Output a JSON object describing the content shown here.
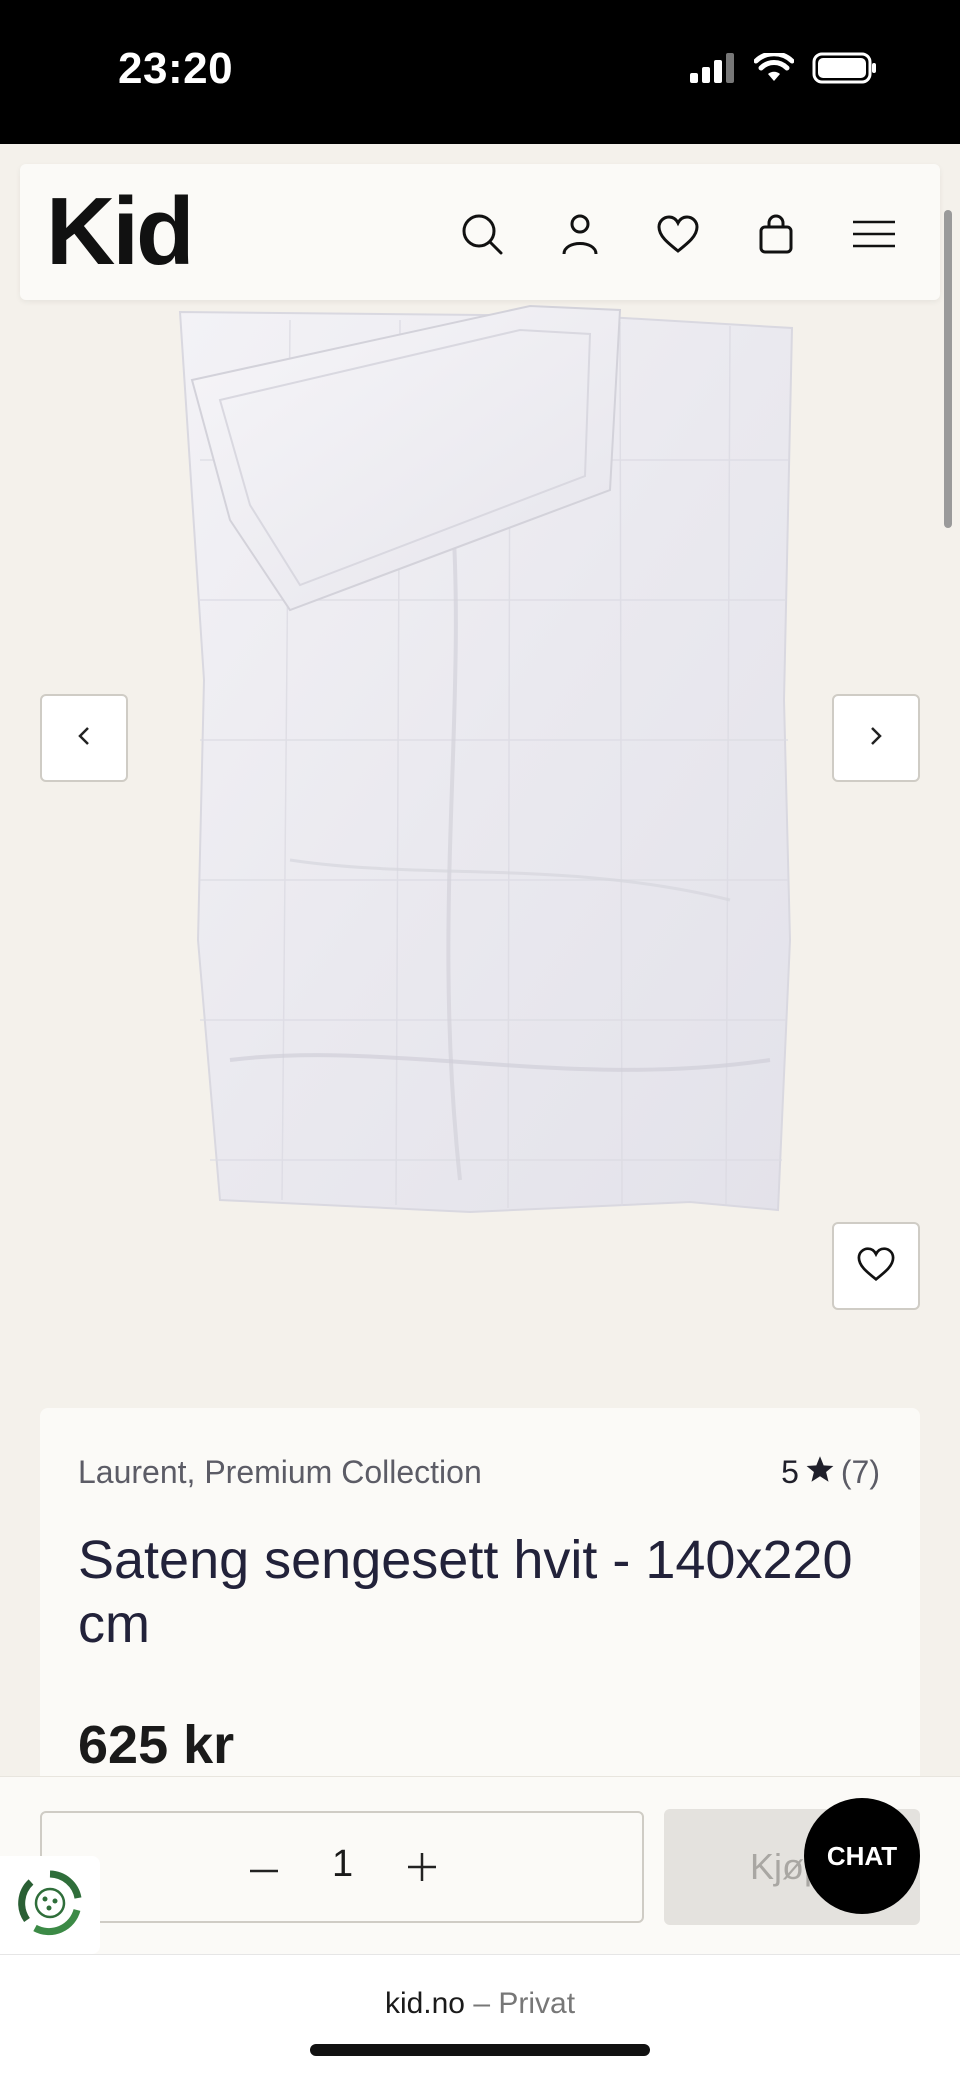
{
  "status_bar": {
    "time": "23:20"
  },
  "header": {
    "logo": "Kid",
    "icons": [
      "search-icon",
      "account-icon",
      "heart-icon",
      "bag-icon",
      "menu-icon"
    ]
  },
  "gallery": {
    "prev_icon": "chevron-left-icon",
    "next_icon": "chevron-right-icon",
    "favorite_icon": "heart-icon"
  },
  "product": {
    "brand": "Laurent, Premium Collection",
    "rating_value": "5",
    "rating_count": "(7)",
    "title": "Sateng sengesett hvit - 140x220 cm",
    "price": "625 kr"
  },
  "buy_bar": {
    "quantity": "1",
    "buy_label": "Kjøp",
    "chat_label": "CHAT"
  },
  "browser": {
    "domain": "kid.no",
    "separator": " – ",
    "mode": "Privat"
  },
  "colors": {
    "page_bg": "#f4f1eb",
    "card_bg": "#fbfaf7",
    "text": "#1f1f2a",
    "buy_disabled": "#e4e2de"
  }
}
